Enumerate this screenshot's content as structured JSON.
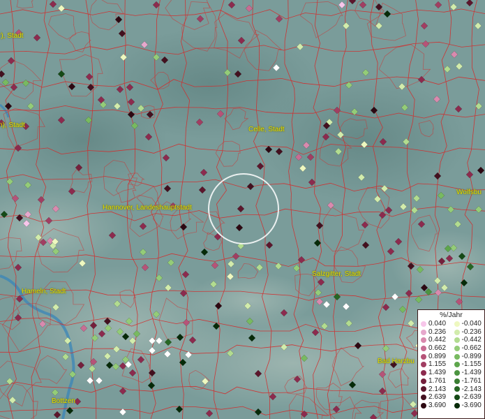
{
  "map": {
    "cities": [
      {
        "id": "stadt-nw",
        "label": "r), Stadt"
      },
      {
        "id": "stadt-w",
        "label": "n), Stadt"
      },
      {
        "id": "celle",
        "label": "Celle, Stadt"
      },
      {
        "id": "wolfsburg",
        "label": "Wolfsbu"
      },
      {
        "id": "hannover",
        "label": "Hannover, Landeshauptstadt"
      },
      {
        "id": "salzgitter",
        "label": "Salzgitter, Stadt"
      },
      {
        "id": "hameln",
        "label": "Hameln, Stadt"
      },
      {
        "id": "bad-harzburg",
        "label": "Bad Harzbu"
      },
      {
        "id": "bottzen",
        "label": "Bottzen"
      }
    ],
    "marker_colors": {
      "pos": [
        "#f7c6ea",
        "#e6a8cc",
        "#d98aae",
        "#c86d93",
        "#b65378",
        "#a13e62",
        "#8c2b4e",
        "#75203c",
        "#5c162c",
        "#43101f",
        "#2d0812"
      ],
      "neg": [
        "#eef8c0",
        "#d2ecac",
        "#b2dc90",
        "#94cc78",
        "#78ba60",
        "#5ea64c",
        "#4c9440",
        "#3a7e32",
        "#276624",
        "#154a16",
        "#062a08"
      ],
      "white": "#ffffff"
    }
  },
  "legend": {
    "title": "%/Jahr",
    "rows": [
      {
        "pos": "0.040",
        "neg": "-0.040"
      },
      {
        "pos": "0.236",
        "neg": "-0.236"
      },
      {
        "pos": "0.442",
        "neg": "-0.442"
      },
      {
        "pos": "0.662",
        "neg": "-0.662"
      },
      {
        "pos": "0.899",
        "neg": "-0.899"
      },
      {
        "pos": "1.155",
        "neg": "-1.155"
      },
      {
        "pos": "1.439",
        "neg": "-1.439"
      },
      {
        "pos": "1.761",
        "neg": "-1.761"
      },
      {
        "pos": "2.143",
        "neg": "-2.143"
      },
      {
        "pos": "2.639",
        "neg": "-2.639"
      },
      {
        "pos": "3.690",
        "neg": "-3.690"
      }
    ]
  }
}
